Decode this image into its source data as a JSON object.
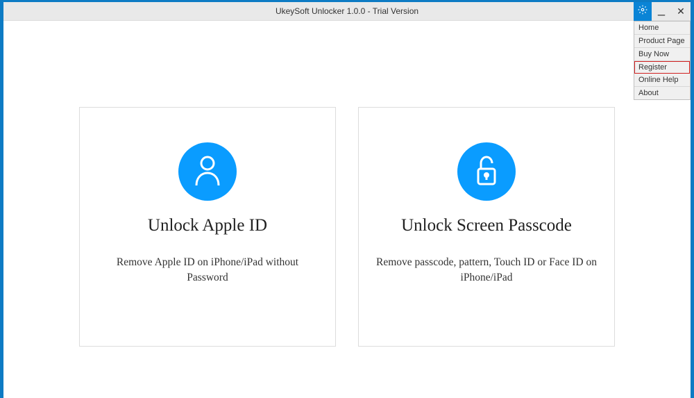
{
  "window": {
    "title": "UkeySoft Unlocker 1.0.0 - Trial Version"
  },
  "menu": {
    "items": [
      {
        "label": "Home"
      },
      {
        "label": "Product Page"
      },
      {
        "label": "Buy Now"
      },
      {
        "label": "Register"
      },
      {
        "label": "Online Help"
      },
      {
        "label": "About"
      }
    ],
    "highlighted_index": 3
  },
  "cards": {
    "apple_id": {
      "title": "Unlock Apple ID",
      "desc": "Remove Apple ID on iPhone/iPad without Password"
    },
    "screen_passcode": {
      "title": "Unlock Screen Passcode",
      "desc": "Remove passcode, pattern, Touch ID or Face ID on iPhone/iPad"
    }
  }
}
